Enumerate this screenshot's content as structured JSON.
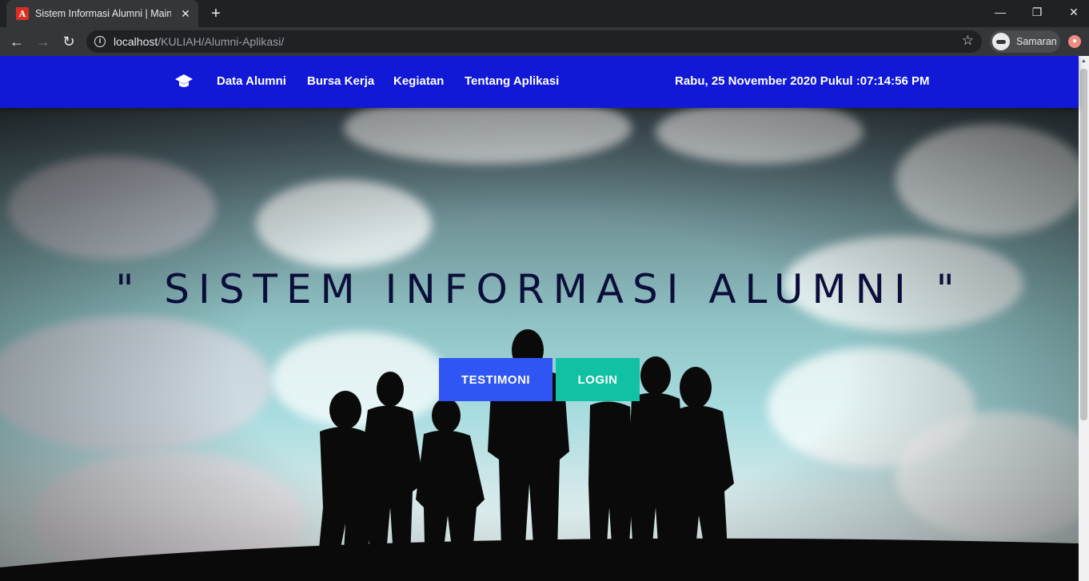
{
  "browser": {
    "tab_title": "Sistem Informasi Alumni | Main",
    "tab_favicon": "A",
    "url_host": "localhost",
    "url_path": "/KULIAH/Alumni-Aplikasi/",
    "profile_label": "Samaran"
  },
  "navbar": {
    "background": "#1119d6",
    "brand_icon": "graduation-cap-icon",
    "links": [
      "Data Alumni",
      "Bursa Kerja",
      "Kegiatan",
      "Tentang Aplikasi"
    ],
    "datetime": "Rabu, 25 November 2020 Pukul :07:14:56 PM"
  },
  "hero": {
    "title": "\" SISTEM INFORMASI ALUMNI \"",
    "buttons": {
      "testimoni": "TESTIMONI",
      "login": "LOGIN"
    },
    "colors": {
      "testimoni": "#2f56f5",
      "login": "#11c1a3"
    }
  }
}
